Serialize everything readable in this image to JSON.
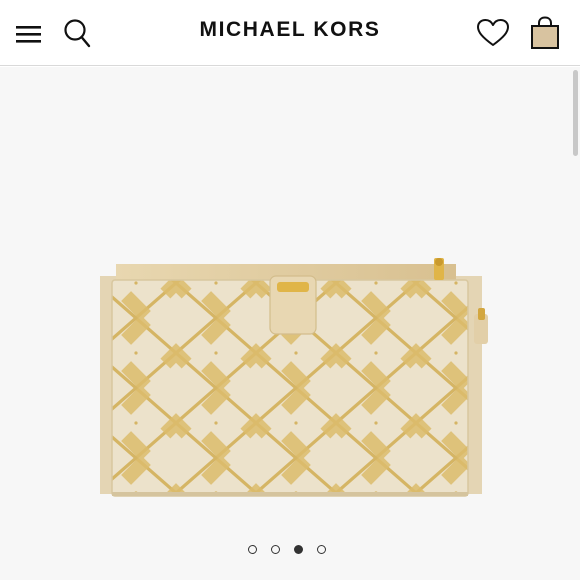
{
  "header": {
    "brand": "MICHAEL KORS",
    "menu_icon": "hamburger-menu-icon",
    "search_icon": "search-icon",
    "wishlist_icon": "heart-icon",
    "bag_icon": "shopping-bag-icon"
  },
  "gallery": {
    "image_count": 4,
    "active_index": 3
  },
  "colors": {
    "canvas": "#ffffff",
    "gallery_bg": "#f7f7f7",
    "wallet_base": "#e9dcc3",
    "wallet_pattern": "#d9b765",
    "hardware": "#e0b548",
    "brand_text": "#111111"
  }
}
